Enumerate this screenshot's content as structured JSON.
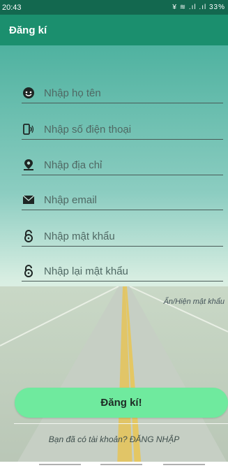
{
  "status_bar": {
    "time": "20:43",
    "icons": "¥ ≋ .ıl .ıl 33%",
    "battery": "33%"
  },
  "app_bar": {
    "title": "Đăng kí"
  },
  "form": {
    "fields": [
      {
        "placeholder": "Nhập họ tên",
        "icon": "face-icon"
      },
      {
        "placeholder": "Nhập số điện thoại",
        "icon": "phone-icon"
      },
      {
        "placeholder": "Nhập địa chỉ",
        "icon": "location-icon"
      },
      {
        "placeholder": "Nhập email",
        "icon": "mail-icon"
      },
      {
        "placeholder": "Nhập mật khẩu",
        "icon": "lock-icon"
      },
      {
        "placeholder": "Nhập lại mật khẩu",
        "icon": "lock-icon"
      }
    ],
    "toggle_password": "Ẩn/Hiện mật khẩu",
    "submit_label": "Đăng kí!",
    "login_prompt": "Bạn đã có tài khoản? ĐĂNG NHẬP"
  },
  "colors": {
    "statusbar": "#13684f",
    "appbar": "#1b8f6e",
    "button": "#6fea9e"
  }
}
